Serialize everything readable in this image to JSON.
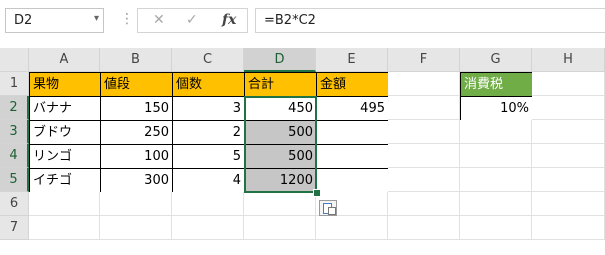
{
  "formula_bar": {
    "name_box": "D2",
    "cancel_icon": "✕",
    "enter_icon": "✓",
    "fx_label": "fx",
    "formula": "=B2*C2"
  },
  "columns": [
    "A",
    "B",
    "C",
    "D",
    "E",
    "F",
    "G",
    "H"
  ],
  "rows": [
    "1",
    "2",
    "3",
    "4",
    "5",
    "6",
    "7"
  ],
  "selected": {
    "column": "D",
    "row": "2",
    "range": "D2:D5"
  },
  "cells": {
    "A1": "果物",
    "B1": "値段",
    "C1": "個数",
    "D1": "合計",
    "E1": "金額",
    "G1": "消費税",
    "A2": "バナナ",
    "B2": "150",
    "C2": "3",
    "D2": "450",
    "E2": "495",
    "G2": "10%",
    "A3": "ブドウ",
    "B3": "250",
    "C3": "2",
    "D3": "500",
    "A4": "リンゴ",
    "B4": "100",
    "C4": "5",
    "D4": "500",
    "A5": "イチゴ",
    "B5": "300",
    "C5": "4",
    "D5": "1200"
  },
  "colors": {
    "header_fill": "#ffc000",
    "tax_header_fill": "#70ad47",
    "copied_fill": "#c6c6c6",
    "selection": "#217346"
  },
  "icons": {
    "name_box_dropdown": "chevron-down-icon",
    "paste_options": "paste-options-icon"
  }
}
